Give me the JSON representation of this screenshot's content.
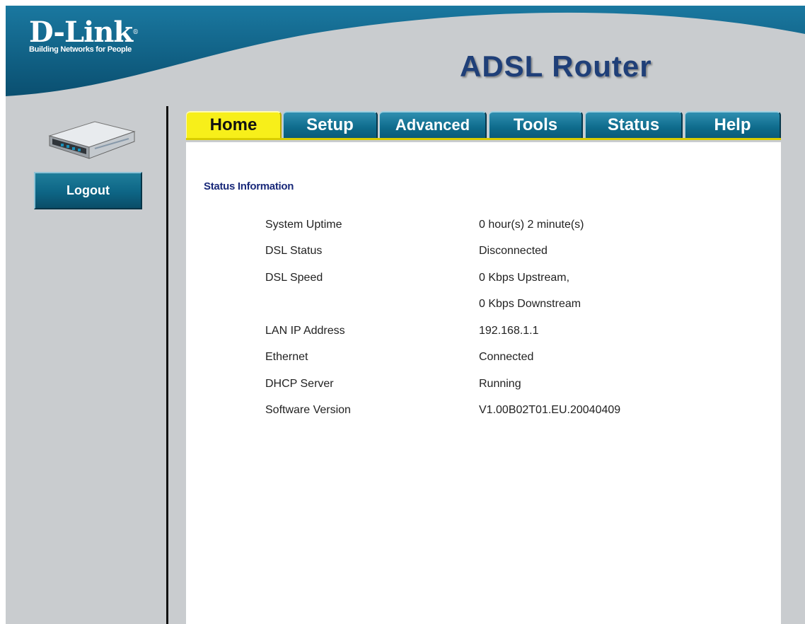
{
  "brand": {
    "logo": "D-Link",
    "logo_mark": "®",
    "tagline": "Building Networks for People"
  },
  "header": {
    "product_title": "ADSL Router"
  },
  "sidebar": {
    "device_icon": "router-device-icon",
    "logout_label": "Logout"
  },
  "tabs": [
    {
      "label": "Home",
      "active": true
    },
    {
      "label": "Setup",
      "active": false
    },
    {
      "label": "Advanced",
      "active": false
    },
    {
      "label": "Tools",
      "active": false
    },
    {
      "label": "Status",
      "active": false
    },
    {
      "label": "Help",
      "active": false
    }
  ],
  "main": {
    "section_title": "Status Information",
    "status_rows": [
      {
        "label": "System Uptime",
        "value": "0 hour(s) 2 minute(s)"
      },
      {
        "label": "DSL Status",
        "value": "Disconnected"
      },
      {
        "label": "DSL Speed",
        "value": "0 Kbps Upstream,"
      },
      {
        "label": "",
        "value": "0 Kbps Downstream"
      },
      {
        "label": "LAN IP Address",
        "value": "192.168.1.1"
      },
      {
        "label": "Ethernet",
        "value": "Connected"
      },
      {
        "label": "DHCP Server",
        "value": "Running"
      },
      {
        "label": "Software Version",
        "value": "V1.00B02T01.EU.20040409"
      }
    ]
  },
  "colors": {
    "header_blue": "#0d5f84",
    "active_tab": "#f7ef1a",
    "tab_blue": "#0e6b8c",
    "section_title": "#1a2a7a",
    "background_gray": "#c9cccf"
  }
}
